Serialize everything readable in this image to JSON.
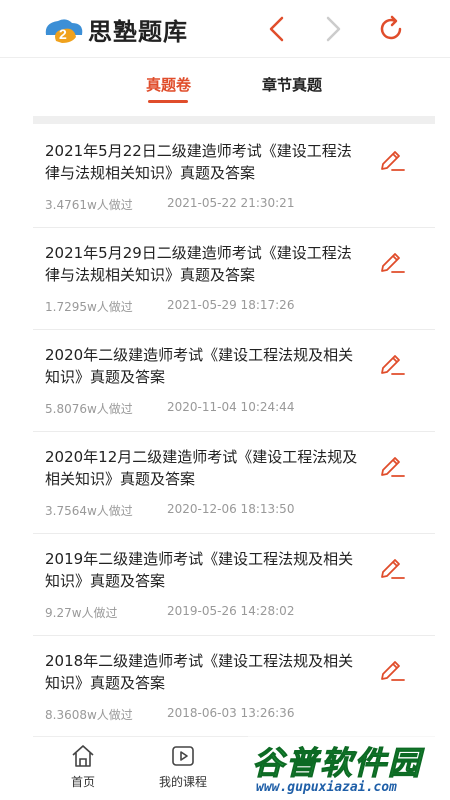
{
  "header": {
    "logo_text": "思塾题库"
  },
  "tabs": [
    {
      "label": "真题卷",
      "active": true
    },
    {
      "label": "章节真题",
      "active": false
    }
  ],
  "items": [
    {
      "title": "2021年5月22日二级建造师考试《建设工程法律与法规相关知识》真题及答案",
      "count": "3.4761w人做过",
      "time": "2021-05-22 21:30:21"
    },
    {
      "title": "2021年5月29日二级建造师考试《建设工程法律与法规相关知识》真题及答案",
      "count": "1.7295w人做过",
      "time": "2021-05-29 18:17:26"
    },
    {
      "title": "2020年二级建造师考试《建设工程法规及相关知识》真题及答案",
      "count": "5.8076w人做过",
      "time": "2020-11-04 10:24:44"
    },
    {
      "title": "2020年12月二级建造师考试《建设工程法规及相关知识》真题及答案",
      "count": "3.7564w人做过",
      "time": "2020-12-06 18:13:50"
    },
    {
      "title": "2019年二级建造师考试《建设工程法规及相关知识》真题及答案",
      "count": "9.27w人做过",
      "time": "2019-05-26 14:28:02"
    },
    {
      "title": "2018年二级建造师考试《建设工程法规及相关知识》真题及答案",
      "count": "8.3608w人做过",
      "time": "2018-06-03 13:26:36"
    }
  ],
  "bottom_nav": [
    {
      "label": "首页",
      "icon": "home-icon"
    },
    {
      "label": "我的课程",
      "icon": "play-icon"
    }
  ],
  "watermark": {
    "title": "谷普软件园",
    "url": "www.gupuxiazai.com"
  },
  "colors": {
    "accent": "#e04d2b"
  }
}
